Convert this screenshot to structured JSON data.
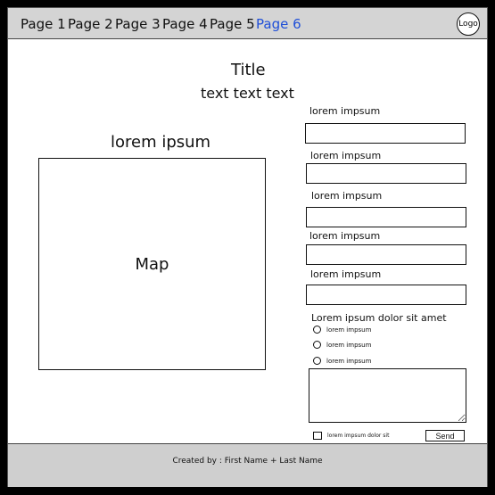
{
  "nav": {
    "items": [
      {
        "label": "Page 1",
        "active": false
      },
      {
        "label": "Page 2",
        "active": false
      },
      {
        "label": "Page 3",
        "active": false
      },
      {
        "label": "Page 4",
        "active": false
      },
      {
        "label": "Page 5",
        "active": false
      },
      {
        "label": "Page 6",
        "active": true
      }
    ],
    "logo": "Logo"
  },
  "header": {
    "title": "Title",
    "subtitle": "text text text"
  },
  "map": {
    "heading": "lorem ipsum",
    "label": "Map"
  },
  "form": {
    "fields": [
      {
        "label": "lorem impsum",
        "value": ""
      },
      {
        "label": "lorem impsum",
        "value": ""
      },
      {
        "label": "lorem impsum",
        "value": ""
      },
      {
        "label": "lorem impsum",
        "value": ""
      },
      {
        "label": "lorem impsum",
        "value": ""
      }
    ],
    "radio_group_label": "Lorem ipsum dolor sit amet",
    "radios": [
      {
        "label": "lorem impsum",
        "checked": false
      },
      {
        "label": "lorem impsum",
        "checked": false
      },
      {
        "label": "lorem impsum",
        "checked": false
      }
    ],
    "textarea_value": "",
    "checkbox_label": "lorem impsum dolor sit",
    "checkbox_checked": false,
    "send_label": "Send"
  },
  "footer": {
    "text": "Created by : First Name + Last Name"
  },
  "colors": {
    "nav_bg": "#d4d4d4",
    "footer_bg": "#cfcfcf",
    "active_link": "#1f4fd8"
  }
}
